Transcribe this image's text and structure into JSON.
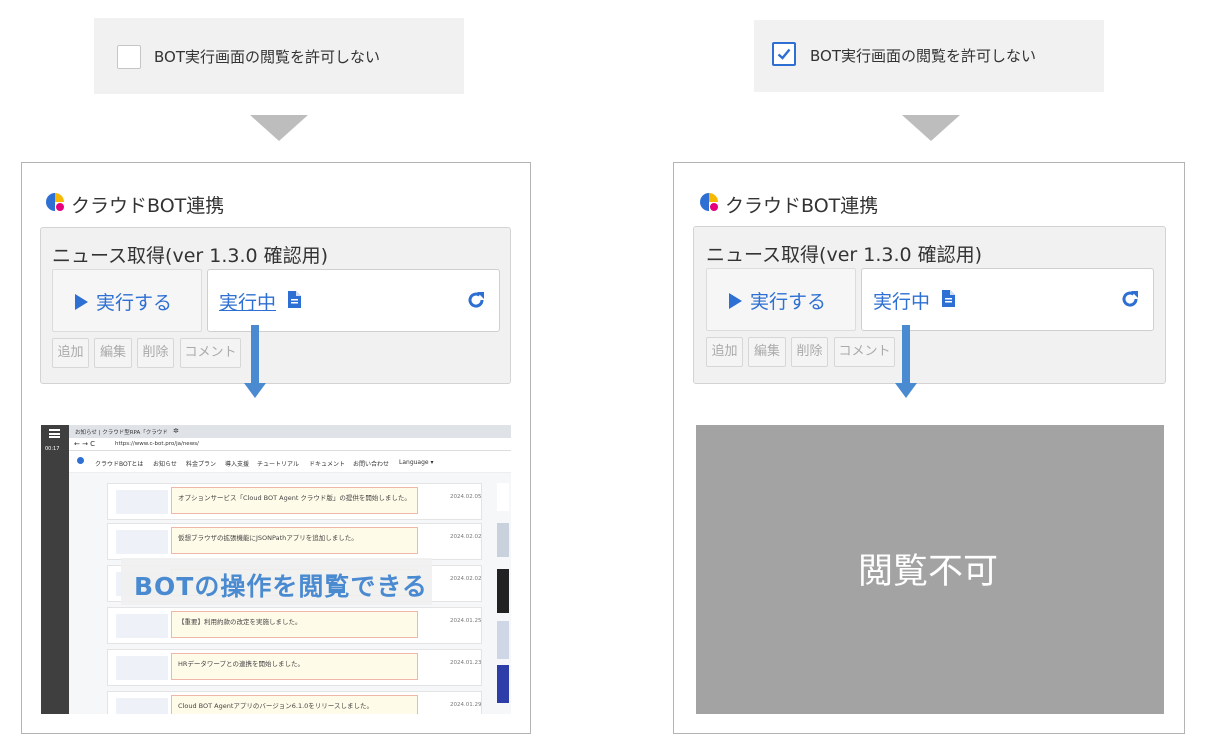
{
  "option_label": "BOT実行画面の閲覧を許可しない",
  "left": {
    "checked": false,
    "panel_title": "クラウドBOT連携",
    "card_title": "ニュース取得(ver 1.3.0 確認用)",
    "run_label": "実行する",
    "status": "実行中",
    "actions": [
      "追加",
      "編集",
      "削除",
      "コメント"
    ],
    "overlay": "BOTの操作を閲覧できる"
  },
  "right": {
    "checked": true,
    "panel_title": "クラウドBOT連携",
    "card_title": "ニュース取得(ver 1.3.0 確認用)",
    "run_label": "実行する",
    "status": "実行中",
    "actions": [
      "追加",
      "編集",
      "削除",
      "コメント"
    ],
    "blocked": "閲覧不可"
  },
  "preview": {
    "tab_title": "お知らせ | クラウド型RPA「クラウド",
    "url": "https://www.c-bot.pro/ja/news/",
    "timer": "00:17",
    "nav": [
      "クラウドBOTとは",
      "お知らせ",
      "料金プラン",
      "導入支援",
      "チュートリアル",
      "ドキュメント",
      "お問い合わせ",
      "Language ▾"
    ],
    "news": [
      {
        "text": "オプションサービス「Cloud BOT Agent クラウド版」の提供を開始しました。",
        "date": "2024.02.05"
      },
      {
        "text": "仮想ブラウザの拡張機能にJSONPathアプリを追加しました。",
        "date": "2024.02.02"
      },
      {
        "text": "",
        "date": "2024.02.02"
      },
      {
        "text": "【重要】利用約款の改定を実施しました。",
        "date": "2024.01.25"
      },
      {
        "text": "HRデータワープとの連携を開始しました。",
        "date": "2024.01.23"
      },
      {
        "text": "Cloud BOT Agentアプリのバージョン6.1.0をリリースしました。",
        "date": "2024.01.29"
      }
    ]
  },
  "colors": {
    "accent": "#2d6fd2",
    "arrow": "#4a8ad1",
    "blocked_bg": "#a3a3a3"
  }
}
